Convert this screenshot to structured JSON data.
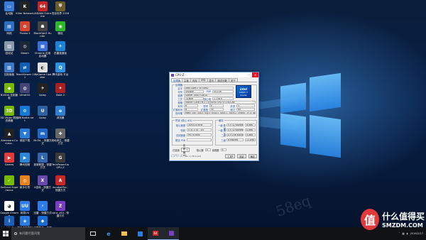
{
  "desktop": {
    "icons": [
      {
        "label": "此电脑",
        "color": "#3a7bd5",
        "glyph": "▭"
      },
      {
        "label": "Killer Network",
        "color": "#222222",
        "glyph": "K"
      },
      {
        "label": "AIDA64 Extreme",
        "color": "#c62828",
        "glyph": "64"
      },
      {
        "label": "坦克世界 2016",
        "color": "#6b5a2a",
        "glyph": "⛨"
      },
      {
        "label": "网络",
        "color": "#2e6fc1",
        "glyph": "▤"
      },
      {
        "label": "Picasa 3",
        "color": "#d8432f",
        "glyph": "✿"
      },
      {
        "label": "BlackOps3 Hunter",
        "color": "#444444",
        "glyph": "☗"
      },
      {
        "label": "微信",
        "color": "#2eb82e",
        "glyph": "◉"
      },
      {
        "label": "回收站",
        "color": "#8899aa",
        "glyph": "▥"
      },
      {
        "label": "Steam",
        "color": "#1b2838",
        "glyph": "◎"
      },
      {
        "label": "Chrome 应用启动器",
        "color": "#3b6fd8",
        "glyph": "▦"
      },
      {
        "label": "迅雷极速版",
        "color": "#1d82d4",
        "glyph": "✈"
      },
      {
        "label": "控制面板",
        "color": "#3c78c4",
        "glyph": "▧"
      },
      {
        "label": "TeamViewer 11",
        "color": "#0e5fb5",
        "glyph": "⇄"
      },
      {
        "label": "WeGame Updater",
        "color": "#e0e0e0",
        "glyph": "◐"
      },
      {
        "label": "腾讯游戏 平台",
        "color": "#2d8fe0",
        "glyph": "Q"
      },
      {
        "label": "NVIDIA 控制面板",
        "color": "#76b900",
        "glyph": "◆"
      },
      {
        "label": "UltraISO",
        "color": "#444477",
        "glyph": "◍"
      },
      {
        "label": "Uplay",
        "color": "#222222",
        "glyph": "✈"
      },
      {
        "label": "Dota 2",
        "color": "#a82020",
        "glyph": "✦"
      },
      {
        "label": "3D Vision 照片查看器",
        "color": "#76b900",
        "glyph": "3D"
      },
      {
        "label": "战网 Battle.net",
        "color": "#1679d8",
        "glyph": "⚙"
      },
      {
        "label": "Uplay",
        "color": "#3060a0",
        "glyph": "U"
      },
      {
        "label": "浏览器",
        "color": "#2f7fd0",
        "glyph": "e"
      },
      {
        "label": "Alienware Comma..",
        "color": "#222222",
        "glyph": "▲"
      },
      {
        "label": "硕鼠下载",
        "color": "#2a7bd6",
        "glyph": "▼"
      },
      {
        "label": "Mr.Ed... 快捷方式",
        "color": "#2166c8",
        "glyph": "m"
      },
      {
        "label": "绝地求生 - 快捷方式",
        "color": "#666666",
        "glyph": "✚"
      },
      {
        "label": "Games",
        "color": "#e23a3a",
        "glyph": "▶"
      },
      {
        "label": "腾讯视频",
        "color": "#2c86d8",
        "glyph": "▶"
      },
      {
        "label": "英雄联盟 - 快捷方式",
        "color": "#3366aa",
        "glyph": "L"
      },
      {
        "label": "TechPowerUp GPU-Z",
        "color": "#3a3a3a",
        "glyph": "G"
      },
      {
        "label": "GeForce Experience",
        "color": "#76b900",
        "glyph": "✓"
      },
      {
        "label": "新手引导",
        "color": "#e8821e",
        "glyph": "◎"
      },
      {
        "label": "X游戏 - 快捷方式",
        "color": "#6a4aa8",
        "glyph": "X"
      },
      {
        "label": "AcrobatPro - 快捷方式",
        "color": "#c62828",
        "glyph": "A"
      },
      {
        "label": "Google Chrome",
        "color": "#ffffff",
        "glyph": "◕"
      },
      {
        "label": "网易UU",
        "color": "#2b7de9",
        "glyph": "UU"
      },
      {
        "label": "迅雷 - 快捷方式",
        "color": "#2b7de9",
        "glyph": "⚡"
      },
      {
        "label": "cpuz_x64 - 快捷方式",
        "color": "#7a3fc0",
        "glyph": "Z"
      },
      {
        "label": "Intel(R) Drive..",
        "color": "#1e5fb4",
        "glyph": "i"
      },
      {
        "label": "腾讯电脑管家 已更新扫描",
        "color": "#2a7de0",
        "glyph": "◈"
      },
      {
        "label": "迅雷影音 - 快捷方式",
        "color": "#1a6dd0",
        "glyph": "◆"
      }
    ]
  },
  "window": {
    "title": "CPU-Z",
    "tabs": [
      "处理器",
      "主板",
      "内存",
      "SPD",
      "显卡",
      "测试分数",
      "关于"
    ],
    "processor_group": "处理器",
    "rows": [
      {
        "label": "名字",
        "value": "Intel Core i7 6700HQ"
      },
      {
        "label": "代号",
        "value": "Skylake"
      },
      {
        "label": "插槽",
        "value": "Socket 1440 FCBGA"
      },
      {
        "label": "工艺",
        "value": "14 纳米"
      },
      {
        "label": "规格",
        "value": "Intel(R) Core(TM) i7-6700HQ CPU @ 2.60GHz"
      },
      {
        "label": "系列",
        "value": "6"
      },
      {
        "label": "扩展系列",
        "value": "6"
      },
      {
        "label": "指令集",
        "value": "MMX, SSE, SSE2, SSE3, SSSE3, SSE4.1, SSE4.2, EM64T, VT-x, AES, AVX, AVX2, FMA3, TSX"
      }
    ],
    "pair_labels": {
      "tdp": "TDP",
      "voltage": "核心电压",
      "model": "型号",
      "step": "步进",
      "ext_model": "扩展型号",
      "revision": "修订"
    },
    "pair_values": {
      "tdp": "45.0 W",
      "voltage": "1.136 V",
      "model": "E",
      "step": "3",
      "ext_model": "5E",
      "revision": "R0"
    },
    "clock_group": "时钟 (核心 #0)",
    "clock_rows": [
      {
        "label": "核心速度",
        "value": "3093.24 MHz"
      },
      {
        "label": "倍频",
        "value": "x 31.0 (8 - 35)"
      },
      {
        "label": "总线速度",
        "value": "99.78 MHz"
      },
      {
        "label": "额定 FSB",
        "value": ""
      }
    ],
    "cache_group": "缓存",
    "cache_rows": [
      {
        "label": "一级 数据",
        "value": "4 x 32 KBytes",
        "way": "8-way"
      },
      {
        "label": "一级 指令",
        "value": "4 x 32 KBytes",
        "way": "8-way"
      },
      {
        "label": "二级",
        "value": "4 x 256 KBytes",
        "way": "4-way"
      },
      {
        "label": "三级",
        "value": "6 MBytes",
        "way": "12-way"
      }
    ],
    "selection": {
      "label": "已选择",
      "value": "处理器 #1",
      "cores_label": "核心数",
      "cores": "4",
      "threads_label": "线程数",
      "threads": "8"
    },
    "footer": {
      "brand": "CPU-Z",
      "version": "Ver. 1.78.0.x64",
      "tools": "工具",
      "validate": "验证",
      "ok": "确定"
    },
    "logo": {
      "line1": "intel",
      "line2": "CORE i7",
      "line3": "inside"
    }
  },
  "taskbar": {
    "search_placeholder": "有问题尽管问我",
    "items": [
      "任务视图",
      "Edge",
      "文件资源管理器",
      "应用商店",
      "AIDA64",
      "CPU-Z"
    ],
    "clock_time": "",
    "clock_date": "2016/2/27"
  },
  "watermark": {
    "badge": "值",
    "text": "什么值得买",
    "site": "SMZDM.COM"
  },
  "colors": {
    "accent": "#1a4fa0",
    "close": "#e81123",
    "taskbar": "#101216"
  }
}
